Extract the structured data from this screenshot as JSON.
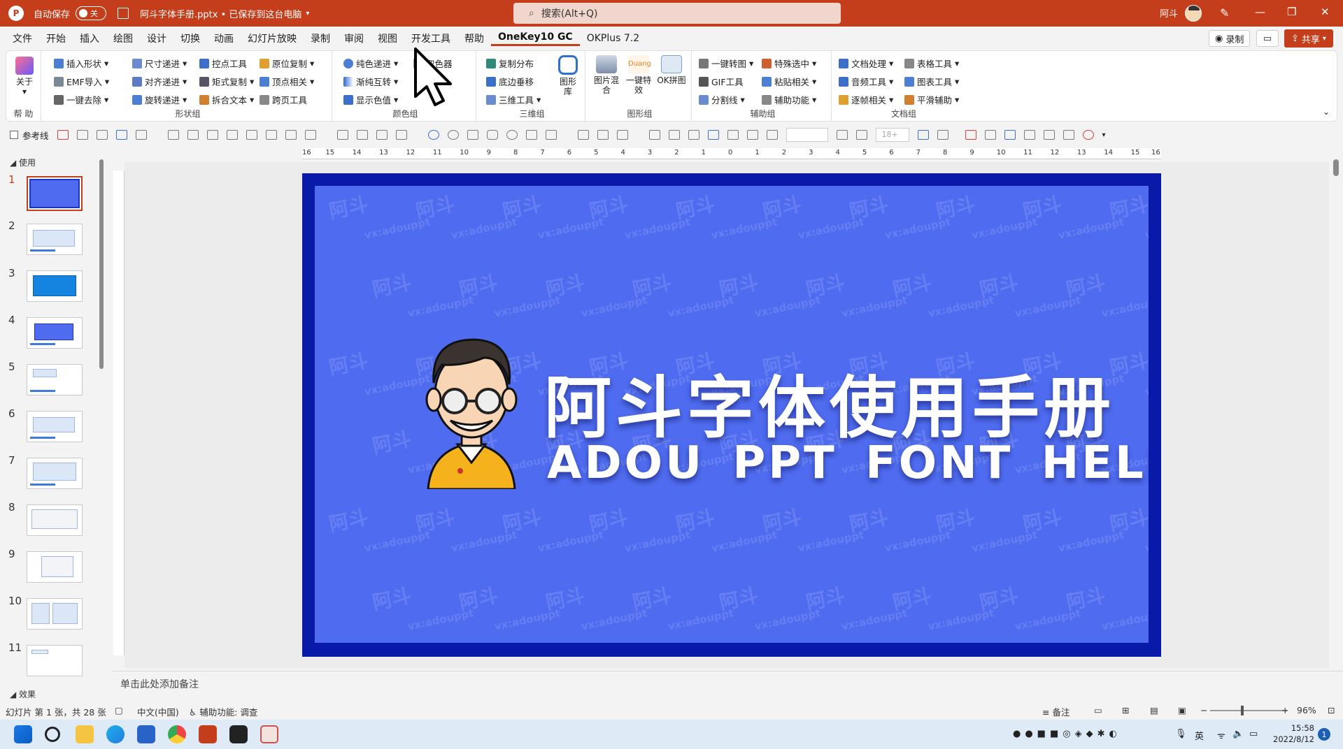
{
  "titlebar": {
    "autosave_label": "自动保存",
    "autosave_state": "关",
    "filename": "阿斗字体手册.pptx • 已保存到这台电脑",
    "search_placeholder": "搜索(Alt+Q)",
    "user_name": "阿斗"
  },
  "menu": {
    "tabs": [
      "文件",
      "开始",
      "插入",
      "绘图",
      "设计",
      "切换",
      "动画",
      "幻灯片放映",
      "录制",
      "审阅",
      "视图",
      "开发工具",
      "帮助",
      "OneKey10 GC",
      "OKPlus 7.2"
    ],
    "active_tab": "OneKey10 GC",
    "record_label": "录制",
    "share_label": "共享"
  },
  "ribbon": {
    "help_group": {
      "item": "关于",
      "label": "帮 助"
    },
    "shape_group": {
      "label": "形状组",
      "items": [
        "插入形状",
        "尺寸递进",
        "控点工具",
        "原位复制",
        "EMF导入",
        "对齐递进",
        "矩式复制",
        "顶点相关",
        "一键去除",
        "旋转递进",
        "拆合文本",
        "跨页工具"
      ]
    },
    "color_group": {
      "label": "颜色组",
      "items": [
        "纯色递进",
        "渐纯互转",
        "显示色值",
        "取色器"
      ]
    },
    "threed_group": {
      "label": "三维组",
      "items": [
        "复制分布",
        "底边垂移",
        "三维工具"
      ],
      "big": "图形库"
    },
    "graphic_group": {
      "label": "图形组",
      "items": [
        "图片混合",
        "一键特效",
        "OK拼图"
      ]
    },
    "assist_group": {
      "label": "辅助组",
      "items": [
        "一键转图",
        "特殊选中",
        "GIF工具",
        "粘贴相关",
        "分割线",
        "辅助功能"
      ]
    },
    "doc_group": {
      "label": "文档组",
      "items": [
        "文档处理",
        "表格工具",
        "音频工具",
        "图表工具",
        "逐帧相关",
        "平滑辅助"
      ]
    }
  },
  "toolbar": {
    "guide_label": "参考线",
    "size_placeholder": "18+"
  },
  "thumbnails": {
    "section_top": "使用",
    "section_bottom": "效果",
    "numbers": [
      "1",
      "2",
      "3",
      "4",
      "5",
      "6",
      "7",
      "8",
      "9",
      "10",
      "11"
    ]
  },
  "ruler": {
    "labels": [
      "16",
      "15",
      "14",
      "13",
      "12",
      "11",
      "10",
      "9",
      "8",
      "7",
      "6",
      "5",
      "4",
      "3",
      "2",
      "1",
      "0",
      "1",
      "2",
      "3",
      "4",
      "5",
      "6",
      "7",
      "8",
      "9",
      "10",
      "11",
      "12",
      "13",
      "14",
      "15",
      "16"
    ]
  },
  "slide": {
    "title": "阿斗字体使用手册",
    "subtitle": "ADOU PPT FONT HELP",
    "watermark_cn": "阿斗",
    "watermark_en": "vx:adouppt",
    "bg_color": "#4f6cf0",
    "frame_color": "#0a1aa8"
  },
  "notes": {
    "placeholder": "单击此处添加备注"
  },
  "status": {
    "slide_info": "幻灯片 第 1 张，共 28 张",
    "language": "中文(中国)",
    "accessibility": "辅助功能: 调查",
    "notes_label": "备注",
    "zoom": "96%"
  },
  "taskbar": {
    "ime": "英",
    "time": "15:58",
    "date": "2022/8/12",
    "notification_count": "1"
  }
}
